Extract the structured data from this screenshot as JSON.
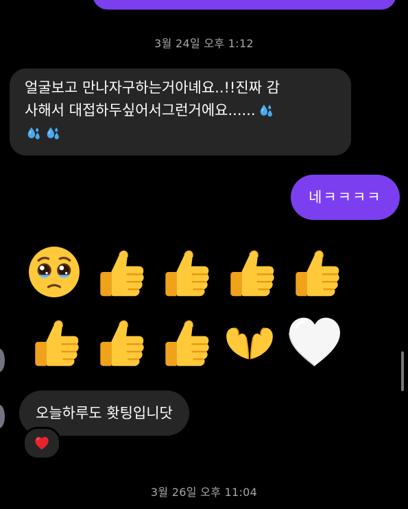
{
  "chat": {
    "timestamp_1": "3월 24일 오후 1:12",
    "message_in_1_line1": "얼굴보고 만나자구하는거아녜요..!!진짜 감",
    "message_in_1_line2": "사해서 대접하두싶어서그런거에요......",
    "message_out_1": "네ㅋㅋㅋㅋ",
    "emoji_rows": [
      [
        "pleading-face",
        "thumbs-up",
        "thumbs-up",
        "thumbs-up",
        "thumbs-up"
      ],
      [
        "thumbs-up",
        "thumbs-up",
        "thumbs-up",
        "heart-hands",
        "white-heart"
      ]
    ],
    "message_in_2": "오늘하루도 홧팅입니닷",
    "reaction": "red-heart",
    "timestamp_2": "3월 26일 오후 11:04"
  },
  "colors": {
    "background": "#000000",
    "incoming_bubble": "#262626",
    "outgoing_bubble": "#7b3ff0",
    "timestamp_text": "#a8a8a8"
  }
}
